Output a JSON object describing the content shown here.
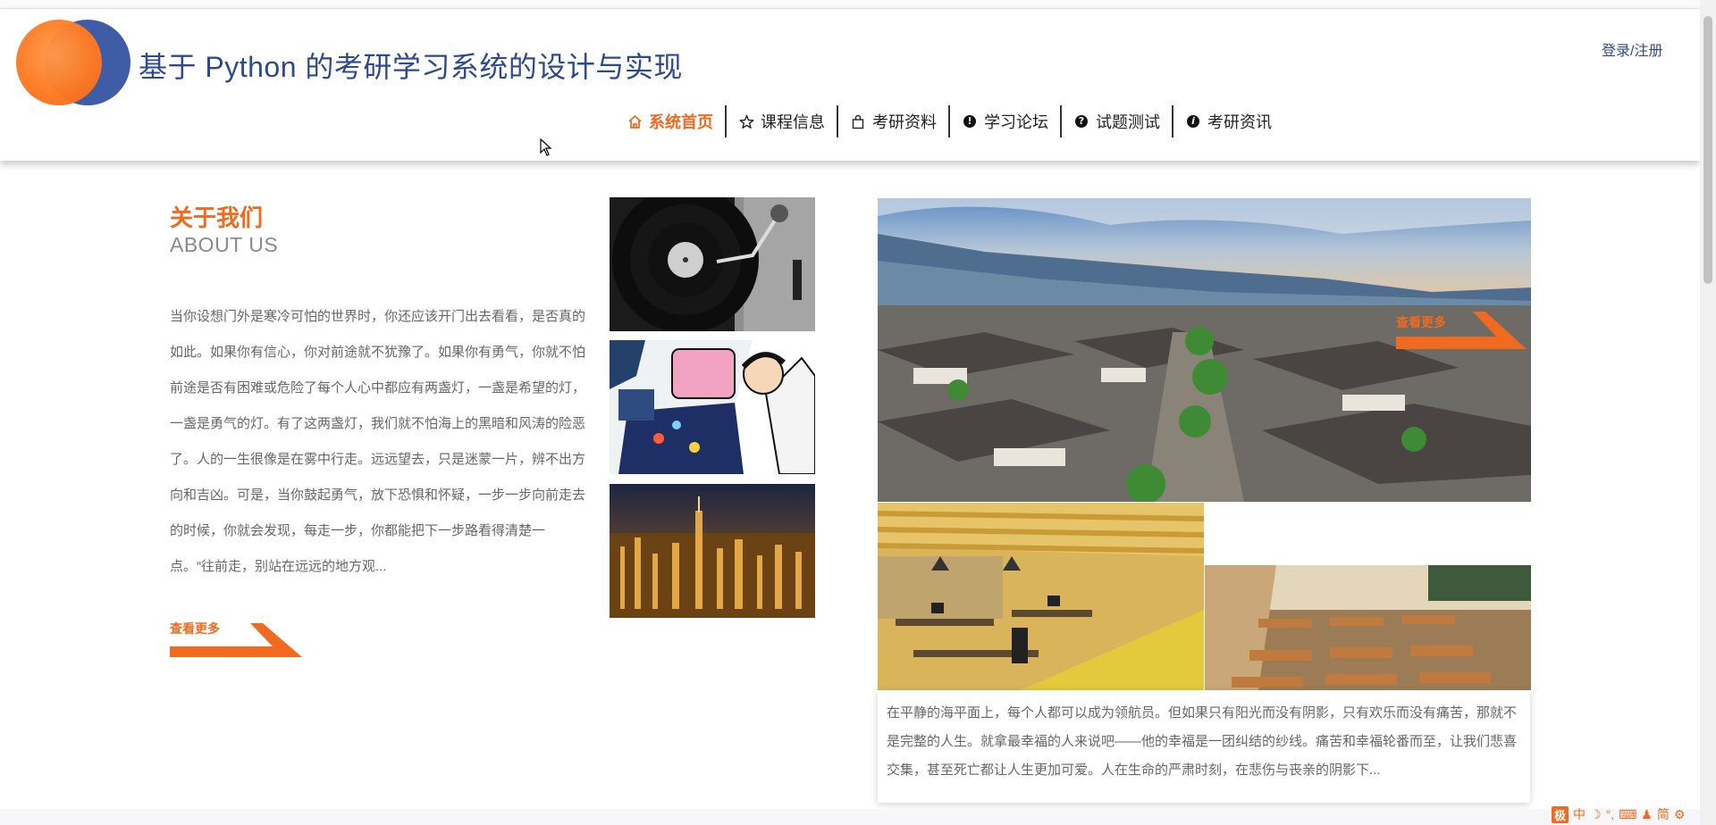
{
  "header": {
    "title": "基于 Python 的考研学习系统的设计与实现",
    "login_label": "登录/注册"
  },
  "nav": {
    "items": [
      {
        "label": "系统首页",
        "icon": "home-icon"
      },
      {
        "label": "课程信息",
        "icon": "star-icon"
      },
      {
        "label": "考研资料",
        "icon": "bag-icon"
      },
      {
        "label": "学习论坛",
        "icon": "exclamation-icon"
      },
      {
        "label": "试题测试",
        "icon": "question-icon"
      },
      {
        "label": "考研资讯",
        "icon": "info-icon"
      }
    ],
    "active_index": 0
  },
  "about": {
    "title": "关于我们",
    "subtitle": "ABOUT US",
    "text": "当你设想门外是寒冷可怕的世界时，你还应该开门出去看看，是否真的如此。如果你有信心，你对前途就不犹豫了。如果你有勇气，你就不怕前途是否有困难或危险了每个人心中都应有两盏灯，一盏是希望的灯，一盏是勇气的灯。有了这两盏灯，我们就不怕海上的黑暗和风涛的险恶了。人的一生很像是在雾中行走。远远望去，只是迷蒙一片，辨不出方向和吉凶。可是，当你鼓起勇气，放下恐惧和怀疑，一步一步向前走去的时候，你就会发现，每走一步，你都能把下一步路看得清楚一点。“往前走，别站在远远的地方观...",
    "more_label": "查看更多"
  },
  "gallery": {
    "overlay_more_label": "查看更多",
    "caption": "在平静的海平面上，每个人都可以成为领航员。但如果只有阳光而没有阴影，只有欢乐而没有痛苦，那就不是完整的人生。就拿最幸福的人来说吧——他的幸福是一团纠结的纱线。痛苦和幸福轮番而至，让我们悲喜交集，甚至死亡都让人生更加可爱。人在生命的严肃时刻，在悲伤与丧亲的阴影下..."
  },
  "ime_bar": {
    "logo": "极",
    "mode": "中",
    "variant": "简"
  },
  "colors": {
    "accent": "#f06a1f",
    "title_blue": "#2e4a8f",
    "text_gray": "#666666"
  }
}
